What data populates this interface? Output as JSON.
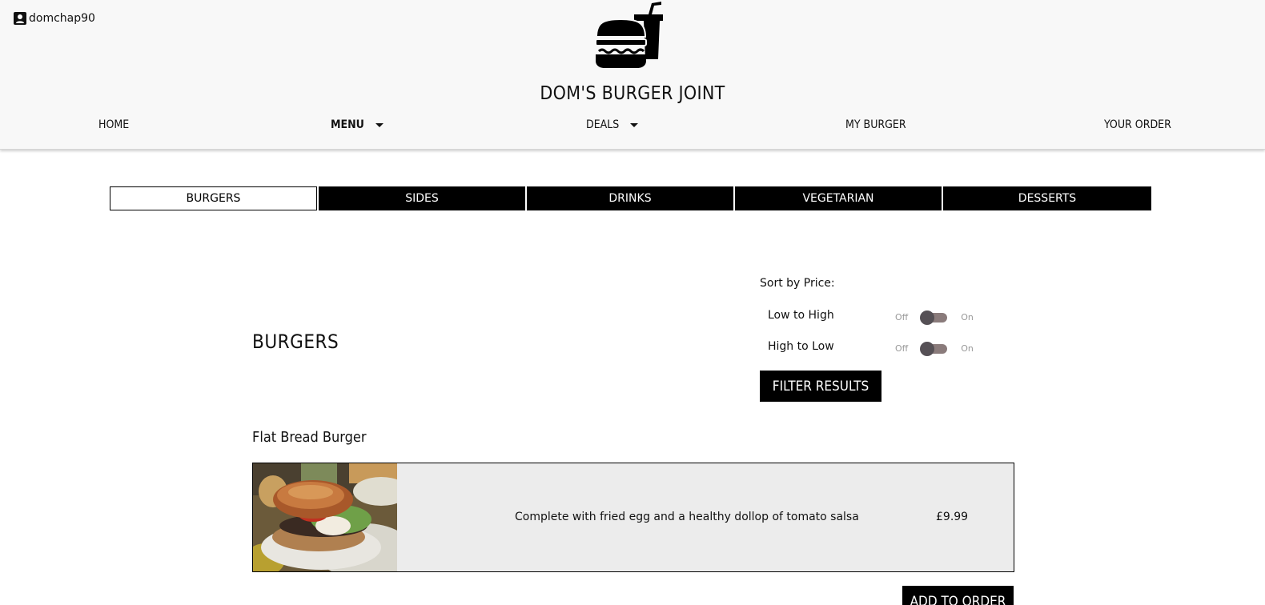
{
  "user": {
    "icon": "user-account-icon",
    "name": "domchap90"
  },
  "logo": {
    "icon": "burger-and-drink-logo"
  },
  "site": {
    "title": "DOM'S BURGER JOINT"
  },
  "nav": {
    "home": "HOME",
    "menu": "MENU",
    "deals": "DEALS",
    "my_burger": "MY BURGER",
    "your_order": "YOUR ORDER"
  },
  "tabs": {
    "burgers": "BURGERS",
    "sides": "SIDES",
    "drinks": "DRINKS",
    "vegetarian": "VEGETARIAN",
    "desserts": "DESSERTS",
    "active": "BURGERS"
  },
  "section": {
    "title": "BURGERS"
  },
  "sort": {
    "label": "Sort by Price:",
    "low_to_high": {
      "label": "Low to High",
      "off": "Off",
      "on": "On",
      "state": "off"
    },
    "high_to_low": {
      "label": "High to Low",
      "off": "Off",
      "on": "On",
      "state": "off"
    },
    "filter_button": "FILTER RESULTS"
  },
  "item": {
    "name": "Flat Bread Burger",
    "description": "Complete with fried egg and a healthy dollop of tomato salsa",
    "price": "£9.99",
    "add_button": "ADD TO ORDER"
  },
  "colors": {
    "header_bg": "#f8f8f8",
    "card_bg": "#ececec",
    "accent": "#000000",
    "toggle_track": "#8a7b7b",
    "toggle_knob": "#555055"
  }
}
